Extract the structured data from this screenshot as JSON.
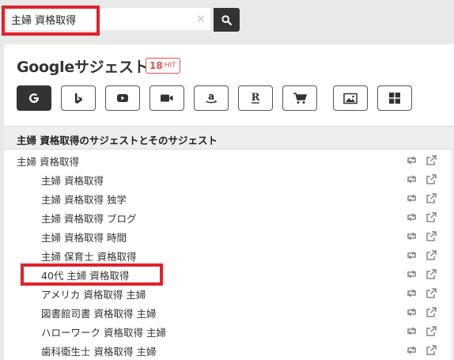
{
  "search": {
    "value": "主婦 資格取得",
    "clear_icon": "×"
  },
  "panel": {
    "title": "Googleサジェスト",
    "hit_count": "18",
    "hit_label": "HIT"
  },
  "engines": [
    "google",
    "bing",
    "youtube",
    "video",
    "amazon",
    "rakuten",
    "shopping",
    "image",
    "apps"
  ],
  "section_heading": "主婦 資格取得のサジェストとそのサジェスト",
  "root_item": "主婦 資格取得",
  "items": [
    "主婦 資格取得",
    "主婦 資格取得 独学",
    "主婦 資格取得 ブログ",
    "主婦 資格取得 時間",
    "主婦 保育士 資格取得",
    "40代 主婦 資格取得",
    "アメリカ 資格取得 主婦",
    "図書館司書 資格取得 主婦",
    "ハローワーク 資格取得 主婦",
    "歯科衛生士 資格取得 主婦"
  ],
  "colors": {
    "highlight": "#e3202a",
    "badge": "#e2514f",
    "dark": "#333333"
  }
}
